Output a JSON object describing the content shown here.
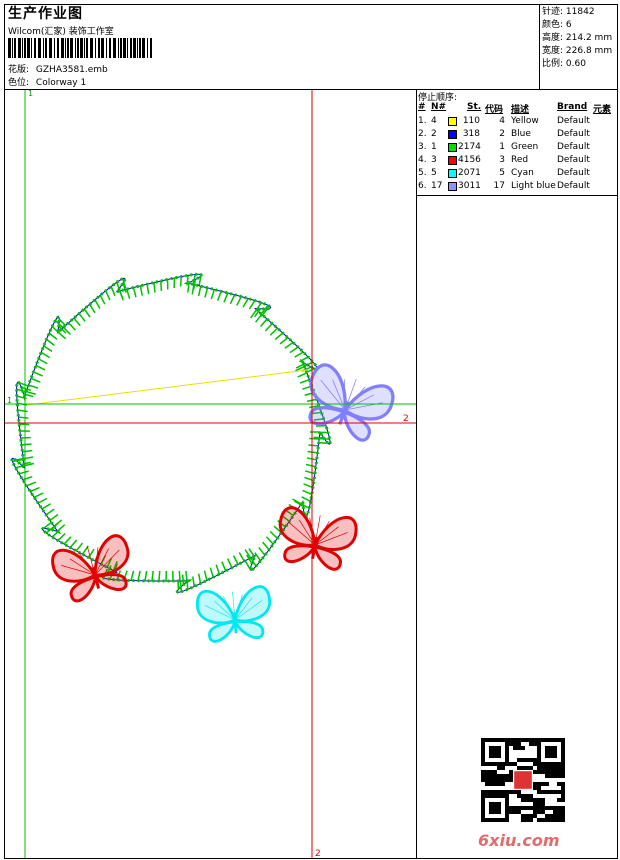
{
  "header": {
    "title": "生产作业图",
    "studio": "Wilcom(汇家) 装饰工作室",
    "design_label": "花版:",
    "design_value": "GZHA3581.emb",
    "colorway_label": "色位:",
    "colorway_value": "Colorway 1"
  },
  "stats": [
    {
      "label": "针迹:",
      "value": "11842"
    },
    {
      "label": "颜色:",
      "value": "6"
    },
    {
      "label": "高度:",
      "value": "214.2 mm"
    },
    {
      "label": "宽度:",
      "value": "226.8 mm"
    },
    {
      "label": "比例:",
      "value": "0.60"
    }
  ],
  "sequence": {
    "title": "停止顺序:",
    "columns": {
      "index": "#",
      "no": "N#",
      "st": "St.",
      "code": "代码",
      "desc": "描述",
      "brand": "Brand",
      "element": "元素"
    },
    "rows": [
      {
        "index": "1.",
        "no": "4",
        "color": "#ffff00",
        "st": "110",
        "code": "4",
        "desc": "Yellow",
        "brand": "Default"
      },
      {
        "index": "2.",
        "no": "2",
        "color": "#0000ff",
        "st": "318",
        "code": "2",
        "desc": "Blue",
        "brand": "Default"
      },
      {
        "index": "3.",
        "no": "1",
        "color": "#00e000",
        "st": "2174",
        "code": "1",
        "desc": "Green",
        "brand": "Default"
      },
      {
        "index": "4.",
        "no": "3",
        "color": "#ff0000",
        "st": "4156",
        "code": "3",
        "desc": "Red",
        "brand": "Default"
      },
      {
        "index": "5.",
        "no": "5",
        "color": "#00ffff",
        "st": "2071",
        "code": "5",
        "desc": "Cyan",
        "brand": "Default"
      },
      {
        "index": "6.",
        "no": "17",
        "color": "#9090ff",
        "st": "3011",
        "code": "17",
        "desc": "Light blue",
        "brand": "Default"
      }
    ]
  },
  "guides": {
    "v1": "1",
    "h1": "1",
    "h2": "2",
    "v2": "2"
  },
  "watermark": "6xiu.com",
  "colors": {
    "green": "#00c000",
    "red": "#e00000",
    "blue": "#0000cc",
    "yellow": "#e8e000",
    "cyan": "#00e8f0",
    "lightblue": "#8080ff"
  }
}
